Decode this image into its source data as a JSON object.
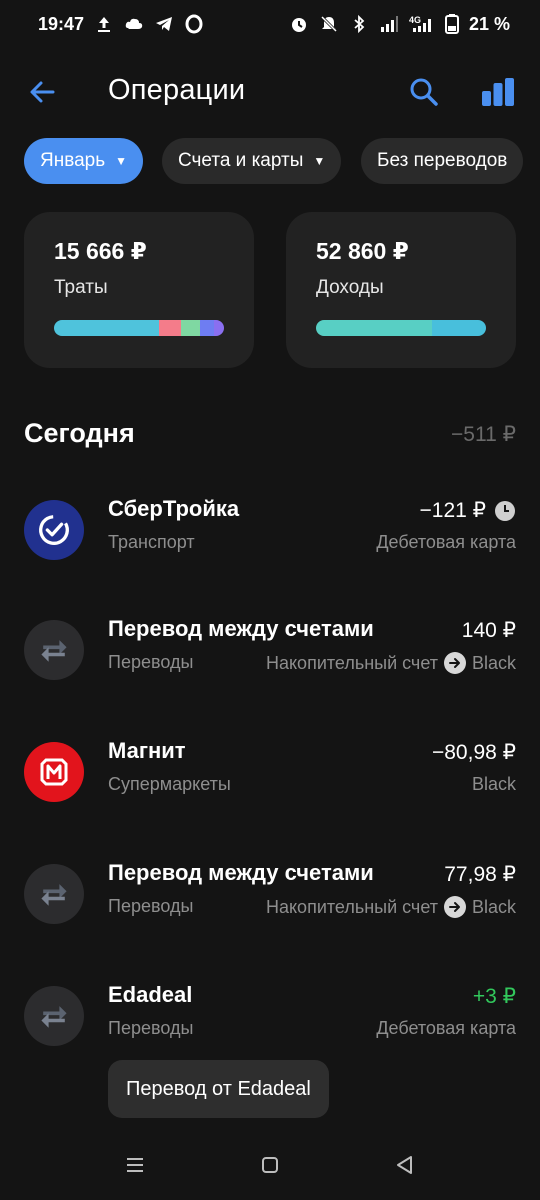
{
  "status_bar": {
    "time": "19:47",
    "network": "4G",
    "battery": "21 %"
  },
  "header": {
    "title": "Операции",
    "back_icon": "arrow-left-icon",
    "search_icon": "search-icon",
    "stats_icon": "bar-chart-icon",
    "accent": "#4a8ff0"
  },
  "filters": [
    {
      "label": "Январь",
      "active": true
    },
    {
      "label": "Счета и карты",
      "active": false
    },
    {
      "label": "Без переводов",
      "active": false
    }
  ],
  "summary": {
    "spend": {
      "amount": "15 666 ₽",
      "label": "Траты",
      "segments": [
        {
          "share": 0.62,
          "color": "#4fc3dc"
        },
        {
          "share": 0.13,
          "color": "#f47c8a"
        },
        {
          "share": 0.11,
          "color": "#7fd8a2"
        },
        {
          "share": 0.08,
          "color": "#6e7df2"
        },
        {
          "share": 0.06,
          "color": "#8a6ff0"
        }
      ]
    },
    "income": {
      "amount": "52 860 ₽",
      "label": "Доходы",
      "segments": [
        {
          "share": 0.68,
          "color": "#58cfc4"
        },
        {
          "share": 0.32,
          "color": "#48bfdc"
        }
      ]
    }
  },
  "section": {
    "title": "Сегодня",
    "total": "−511 ₽"
  },
  "operations": [
    {
      "name": "СберТройка",
      "category": "Транспорт",
      "amount": "−121 ₽",
      "account": "Дебетовая карта",
      "icon": "sbertroika-logo-icon",
      "pending": true
    },
    {
      "name": "Перевод между счетами",
      "category": "Переводы",
      "amount": "140 ₽",
      "account_from": "Накопительный счет",
      "account_to": "Black",
      "icon": "transfer-icon"
    },
    {
      "name": "Магнит",
      "category": "Супермаркеты",
      "amount": "−80,98 ₽",
      "account": "Black",
      "icon": "magnit-logo-icon"
    },
    {
      "name": "Перевод между счетами",
      "category": "Переводы",
      "amount": "77,98 ₽",
      "account_from": "Накопительный счет",
      "account_to": "Black",
      "icon": "transfer-icon"
    },
    {
      "name": "Edadeal",
      "category": "Переводы",
      "amount": "+3 ₽",
      "account": "Дебетовая карта",
      "icon": "transfer-icon",
      "income_color": "#32c85c"
    }
  ],
  "toast": {
    "text": "Перевод от Edadeal"
  }
}
